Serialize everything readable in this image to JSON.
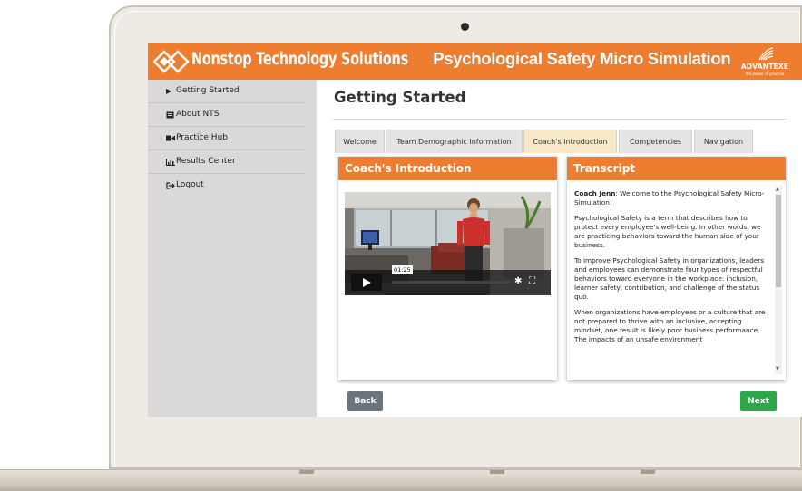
{
  "header": {
    "title_company": "Nonstop Technology Solutions",
    "title_rest": " Psychological Safety Micro Simulation",
    "brand_name": "ADVANTEXE",
    "brand_tagline": "the power of practice",
    "color": "#ee7d30"
  },
  "sidebar": {
    "items": [
      {
        "icon": "play-icon",
        "glyph": "▶",
        "label": "Getting Started"
      },
      {
        "icon": "book-icon",
        "glyph": "📖",
        "label": "About NTS"
      },
      {
        "icon": "video-camera-icon",
        "glyph": "■◂",
        "label": "Practice Hub"
      },
      {
        "icon": "chart-icon",
        "glyph": "📊",
        "label": "Results Center"
      },
      {
        "icon": "logout-icon",
        "glyph": "⇥",
        "label": "Logout"
      }
    ]
  },
  "main": {
    "page_title": "Getting Started",
    "tabs": [
      {
        "label": "Welcome",
        "active": false
      },
      {
        "label": "Team Demographic Information",
        "active": false
      },
      {
        "label": "Coach's Introduction",
        "active": true
      },
      {
        "label": "Competencies",
        "active": false
      },
      {
        "label": "Navigation",
        "active": false
      }
    ],
    "coach_card": {
      "heading": "Coach's Introduction",
      "video_time": "01:25"
    },
    "transcript_card": {
      "heading": "Transcript",
      "speaker": "Coach Jenn",
      "intro": ": Welcome to the Psychological Safety Micro-Simulation!",
      "paragraphs": [
        "Psychological Safety is a term that describes how to protect every employee's well-being. In other words, we are practicing behaviors toward the human-side of your business.",
        "To improve Psychological Safety in organizations, leaders and employees can demonstrate four types of respectful behaviors toward everyone in the workplace: inclusion, learner safety, contribution, and challenge of the status quo.",
        "When organizations have employees or a culture that are not prepared to thrive with an inclusive, accepting mindset, one result is likely poor business performance. The impacts of an unsafe environment"
      ]
    },
    "back_label": "Back",
    "next_label": "Next"
  }
}
